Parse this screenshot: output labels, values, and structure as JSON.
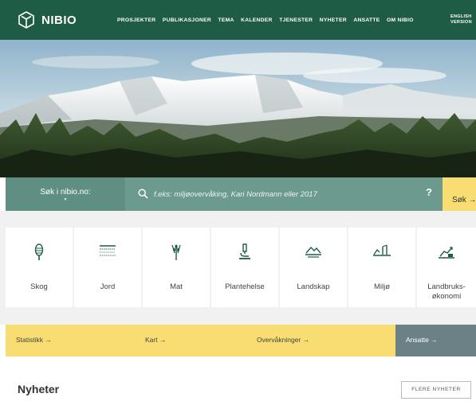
{
  "brand": {
    "name": "NIBIO"
  },
  "nav": {
    "items": [
      {
        "label": "PROSJEKTER"
      },
      {
        "label": "PUBLIKASJONER"
      },
      {
        "label": "TEMA"
      },
      {
        "label": "KALENDER"
      },
      {
        "label": "TJENESTER"
      },
      {
        "label": "NYHETER"
      },
      {
        "label": "ANSATTE"
      },
      {
        "label": "OM NIBIO"
      }
    ],
    "language_line1": "ENGLISH",
    "language_line2": "VERSION"
  },
  "search": {
    "scope_label": "Søk i nibio.no:",
    "placeholder": "f.eks: miljøovervåking, Kari Nordmann eller 2017",
    "help_label": "?",
    "submit_label": "Søk →"
  },
  "topics": [
    {
      "label": "Skog",
      "icon": "tree-icon"
    },
    {
      "label": "Jord",
      "icon": "soil-layers-icon"
    },
    {
      "label": "Mat",
      "icon": "wheat-icon"
    },
    {
      "label": "Plantehelse",
      "icon": "microscope-icon"
    },
    {
      "label": "Landskap",
      "icon": "landscape-icon"
    },
    {
      "label": "Miljø",
      "icon": "environment-icon"
    },
    {
      "label": "Landbruks-økonomi",
      "icon": "economy-chart-icon"
    }
  ],
  "quick_links": [
    {
      "label": "Statistikk →"
    },
    {
      "label": "Kart →"
    },
    {
      "label": "Overvåkninger →"
    },
    {
      "label": "Ansatte →"
    }
  ],
  "news": {
    "title": "Nyheter",
    "more_label": "FLERE NYHETER"
  },
  "colors": {
    "header_green": "#1e5c45",
    "search_green": "#6d9a8e",
    "accent_yellow": "#f7dd72",
    "slate": "#6c8186"
  }
}
